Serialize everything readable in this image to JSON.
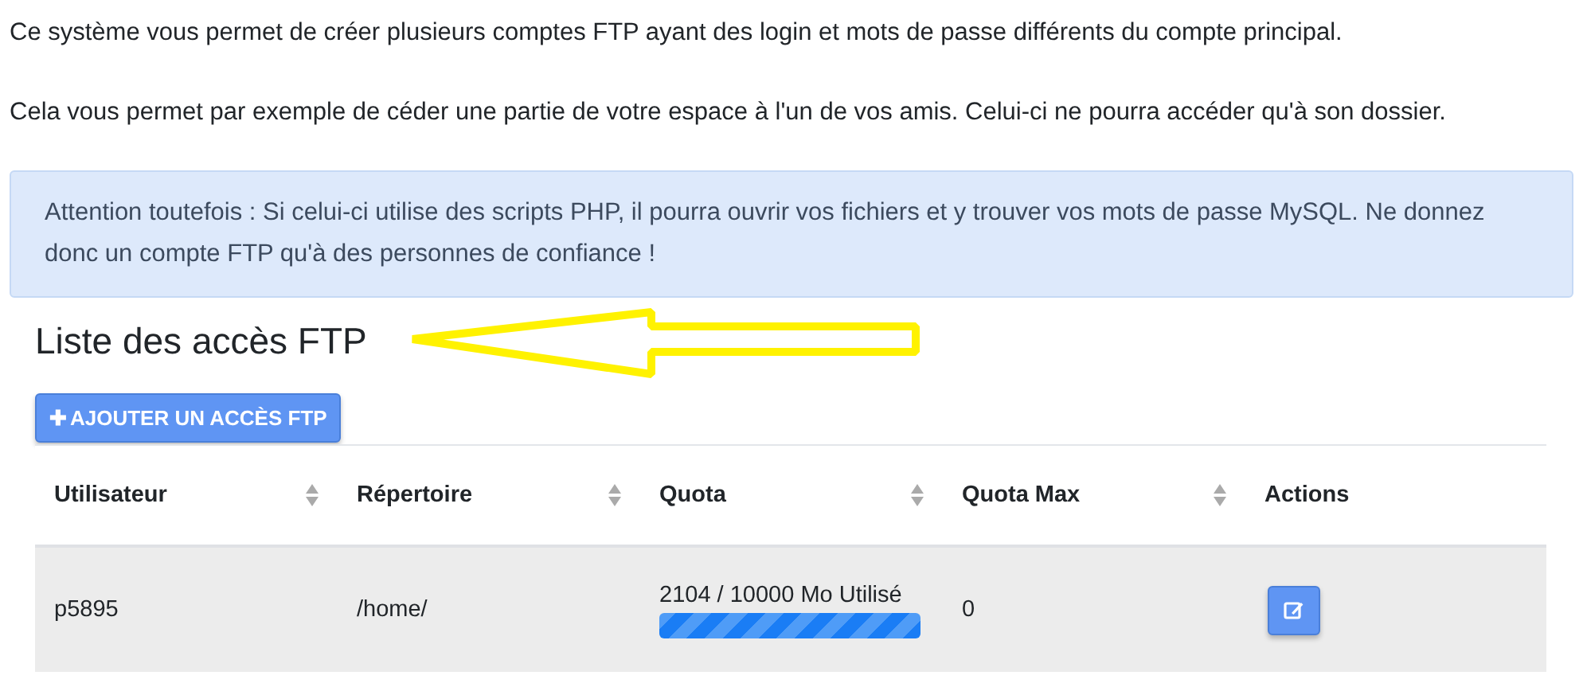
{
  "intro": [
    "Ce système vous permet de créer plusieurs comptes FTP ayant des login et mots de passe différents du compte principal.",
    "Cela vous permet par exemple de céder une partie de votre espace à l'un de vos amis. Celui-ci ne pourra accéder qu'à son dossier."
  ],
  "alert": "Attention toutefois : Si celui-ci utilise des scripts PHP, il pourra ouvrir vos fichiers et y trouver vos mots de passe MySQL. Ne donnez donc un compte FTP qu'à des personnes de confiance !",
  "heading": "Liste des accès FTP",
  "add_button": {
    "icon": "✚",
    "label": "AJOUTER UN ACCÈS FTP"
  },
  "table": {
    "columns": [
      "Utilisateur",
      "Répertoire",
      "Quota",
      "Quota Max",
      "Actions"
    ],
    "rows": [
      {
        "user": "p5895",
        "directory": "/home/",
        "quota": "2104 / 10000 Mo Utilisé",
        "level": 1,
        "quota_max": "0"
      }
    ]
  }
}
